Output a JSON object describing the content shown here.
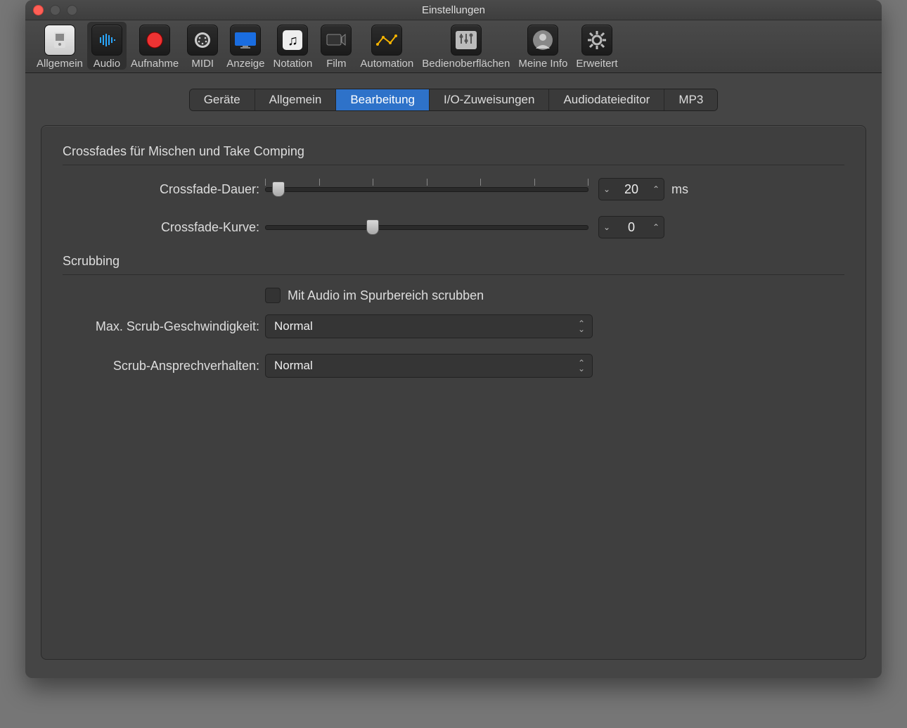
{
  "window_title": "Einstellungen",
  "toolbar": [
    {
      "id": "general",
      "label": "Allgemein",
      "selected": false
    },
    {
      "id": "audio",
      "label": "Audio",
      "selected": true
    },
    {
      "id": "record",
      "label": "Aufnahme",
      "selected": false
    },
    {
      "id": "midi",
      "label": "MIDI",
      "selected": false
    },
    {
      "id": "display",
      "label": "Anzeige",
      "selected": false
    },
    {
      "id": "notation",
      "label": "Notation",
      "selected": false
    },
    {
      "id": "movie",
      "label": "Film",
      "selected": false
    },
    {
      "id": "automation",
      "label": "Automation",
      "selected": false
    },
    {
      "id": "surfaces",
      "label": "Bedienoberflächen",
      "selected": false
    },
    {
      "id": "myinfo",
      "label": "Meine Info",
      "selected": false
    },
    {
      "id": "advanced",
      "label": "Erweitert",
      "selected": false
    }
  ],
  "subtabs": [
    {
      "id": "devices",
      "label": "Geräte",
      "active": false
    },
    {
      "id": "general",
      "label": "Allgemein",
      "active": false
    },
    {
      "id": "editing",
      "label": "Bearbeitung",
      "active": true
    },
    {
      "id": "io",
      "label": "I/O-Zuweisungen",
      "active": false
    },
    {
      "id": "audiofile",
      "label": "Audiodateieditor",
      "active": false
    },
    {
      "id": "mp3",
      "label": "MP3",
      "active": false
    }
  ],
  "sections": {
    "crossfades": {
      "title": "Crossfades für Mischen und Take Comping",
      "duration": {
        "label": "Crossfade-Dauer:",
        "value": "20",
        "unit": "ms",
        "ticks": 7,
        "thumb_pct": 4
      },
      "curve": {
        "label": "Crossfade-Kurve:",
        "value": "0",
        "thumb_pct": 33
      }
    },
    "scrubbing": {
      "title": "Scrubbing",
      "checkbox": {
        "label": "Mit Audio im Spurbereich scrubben",
        "checked": false
      },
      "max_speed": {
        "label": "Max. Scrub-Geschwindigkeit:",
        "value": "Normal"
      },
      "response": {
        "label": "Scrub-Ansprechverhalten:",
        "value": "Normal"
      }
    }
  }
}
